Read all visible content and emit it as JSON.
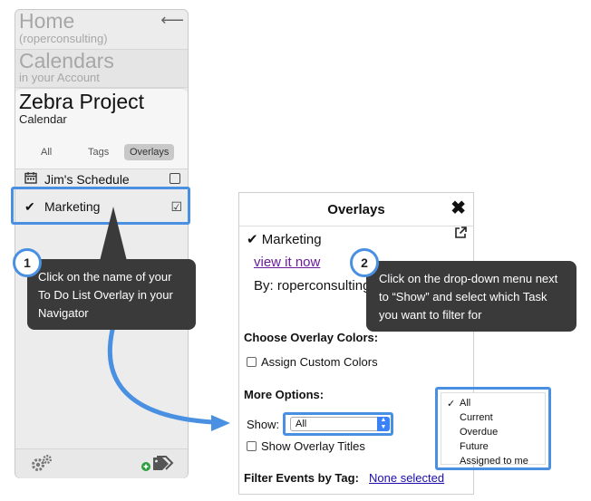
{
  "nav": {
    "home_title": "Home",
    "home_sub": "(roperconsulting)",
    "cal_title": "Calendars",
    "cal_sub": "in your Account",
    "proj_title": "Zebra Project",
    "proj_sub": "Calendar",
    "tabs": [
      "All",
      "Tags",
      "Overlays"
    ],
    "active_tab": "Overlays",
    "items": [
      {
        "label": "Jim's Schedule",
        "icon": "calendar-icon",
        "checked": false
      },
      {
        "label": "Marketing",
        "icon": "checkmark-icon",
        "checked": true
      }
    ]
  },
  "callouts": {
    "step1": "1",
    "step1_text": "Click on the name of your To Do List Overlay in your Navigator",
    "step2": "2",
    "step2_text": "Click on the drop-down menu next to “Show” and select which Task you want to filter for"
  },
  "overlay_panel": {
    "title": "Overlays",
    "overlay_name": "Marketing",
    "view_link": "view it now",
    "by_prefix": "By:",
    "by_value": "roperconsulting",
    "colors_heading": "Choose Overlay Colors:",
    "assign_custom": "Assign Custom Colors",
    "more_heading": "More Options:",
    "show_label": "Show:",
    "show_value": "All",
    "show_titles": "Show Overlay Titles",
    "filter_label": "Filter Events by Tag:",
    "filter_link": "None selected"
  },
  "show_options": [
    "All",
    "Current",
    "Overdue",
    "Future",
    "Assigned to me"
  ],
  "selected_option": "All",
  "colors": {
    "accent_blue": "#4a90e2",
    "bubble_dark": "#3a3a3a",
    "link_purple": "#6a1b9a",
    "link_blue": "#1a0dab"
  }
}
